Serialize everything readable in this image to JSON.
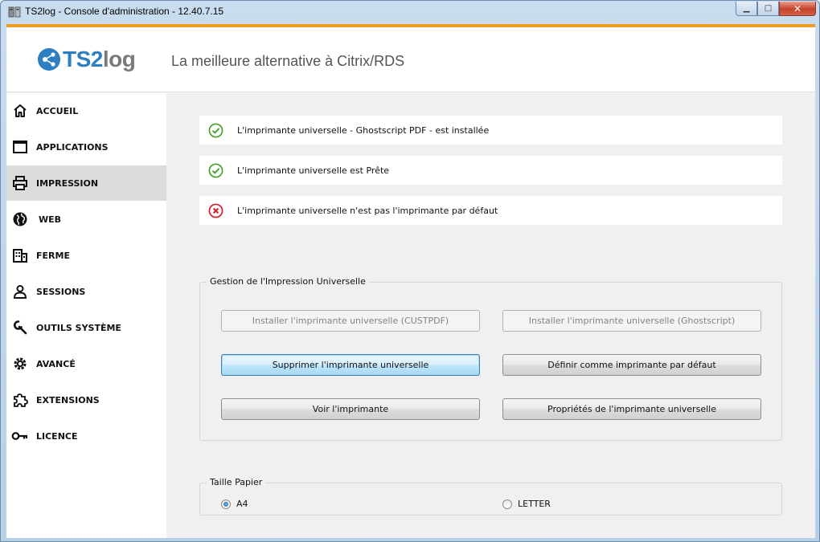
{
  "window": {
    "title": "TS2log - Console d'administration - 12.40.7.15",
    "minimize_icon": "minimize-icon",
    "maximize_icon": "maximize-icon",
    "close_icon": "close-icon"
  },
  "header": {
    "logo_ts": "TS",
    "logo_2": "2",
    "logo_log": "log",
    "tagline": "La meilleure alternative à Citrix/RDS",
    "accent_color": "#f29c1f"
  },
  "sidebar": {
    "items": [
      {
        "label": "ACCUEIL",
        "icon": "home-icon"
      },
      {
        "label": "APPLICATIONS",
        "icon": "window-icon"
      },
      {
        "label": "IMPRESSION",
        "icon": "printer-icon",
        "active": true
      },
      {
        "label": "WEB",
        "icon": "globe-icon"
      },
      {
        "label": "FERME",
        "icon": "building-icon"
      },
      {
        "label": "SESSIONS",
        "icon": "user-icon"
      },
      {
        "label": "OUTILS SYSTÈME",
        "icon": "wrench-icon"
      },
      {
        "label": "AVANCÉ",
        "icon": "gear-icon"
      },
      {
        "label": "EXTENSIONS",
        "icon": "puzzle-icon"
      },
      {
        "label": "LICENCE",
        "icon": "key-icon"
      }
    ]
  },
  "status": [
    {
      "text": "L'imprimante universelle - Ghostscript PDF - est installée",
      "state": "ok",
      "icon": "check-circle-icon",
      "color": "#4aa02c"
    },
    {
      "text": "L'imprimante universelle est Prête",
      "state": "ok",
      "icon": "check-circle-icon",
      "color": "#4aa02c"
    },
    {
      "text": "L'imprimante universelle n'est pas l'imprimante par défaut",
      "state": "error",
      "icon": "x-circle-icon",
      "color": "#d0202a"
    }
  ],
  "management": {
    "title": "Gestion de l'Impression Universelle",
    "buttons": {
      "install_custpdf": "Installer l'imprimante universelle (CUSTPDF)",
      "install_ghostscript": "Installer l'imprimante universelle (Ghostscript)",
      "remove": "Supprimer l'imprimante universelle",
      "set_default": "Définir comme imprimante par défaut",
      "view": "Voir l'imprimante",
      "properties": "Propriétés de l'imprimante universelle"
    }
  },
  "paper": {
    "title": "Taille Papier",
    "options": [
      {
        "label": "A4",
        "checked": true
      },
      {
        "label": "LETTER",
        "checked": false
      }
    ]
  }
}
